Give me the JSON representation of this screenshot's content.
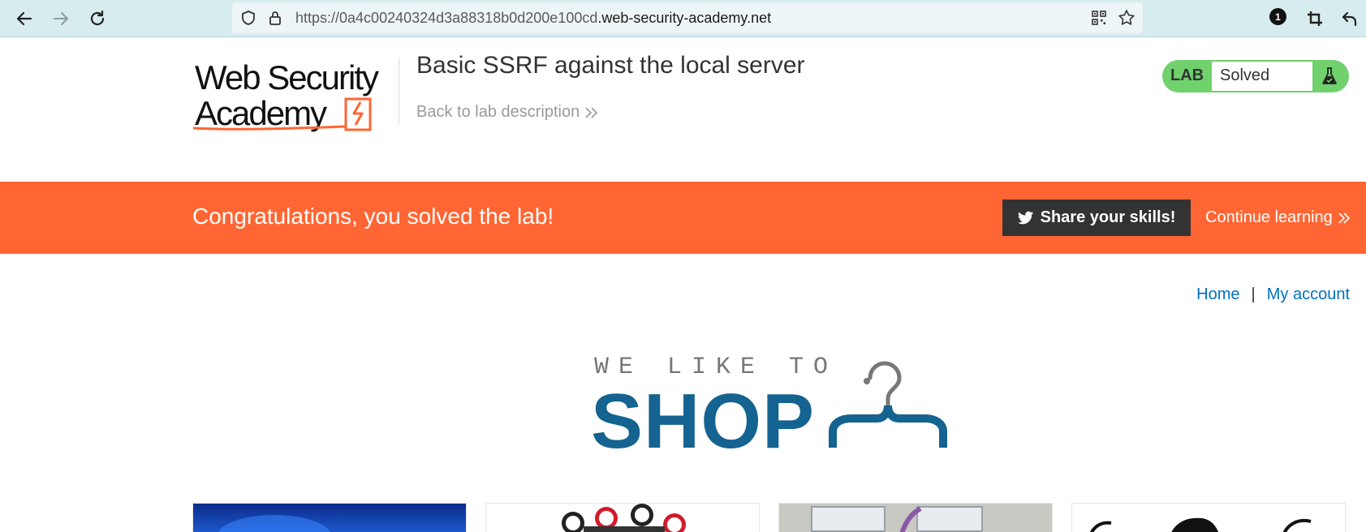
{
  "browser": {
    "url_prefix": "https://0a4c00240324d3a88318b0d200e100cd",
    "url_domain": ".web-security-academy.net",
    "extension_badge": "1"
  },
  "header": {
    "logo_text_line1": "Web Security",
    "logo_text_line2": "Academy",
    "lab_title": "Basic SSRF against the local server",
    "back_link": "Back to lab description",
    "lab_tag": "LAB",
    "lab_state": "Solved"
  },
  "banner": {
    "message": "Congratulations, you solved the lab!",
    "share_label": "Share your skills!",
    "continue_label": "Continue learning"
  },
  "nav": {
    "home": "Home",
    "separator": "|",
    "account": "My account"
  },
  "shop_logo": {
    "tagline": "WE LIKE TO",
    "word": "SHOP"
  },
  "colors": {
    "chrome": "#d7ecef",
    "accent_orange": "#ff6633",
    "lab_green": "#70d16d",
    "link_blue": "#0071bc",
    "shop_blue": "#156390"
  },
  "icons": {
    "back": "arrow-left-icon",
    "forward": "arrow-right-icon",
    "reload": "reload-icon",
    "shield": "shield-icon",
    "lock": "lock-icon",
    "qr": "qr-code-icon",
    "star": "star-icon",
    "crop": "crop-icon",
    "undo": "undo-icon",
    "flask": "flask-icon",
    "twitter": "twitter-icon"
  }
}
